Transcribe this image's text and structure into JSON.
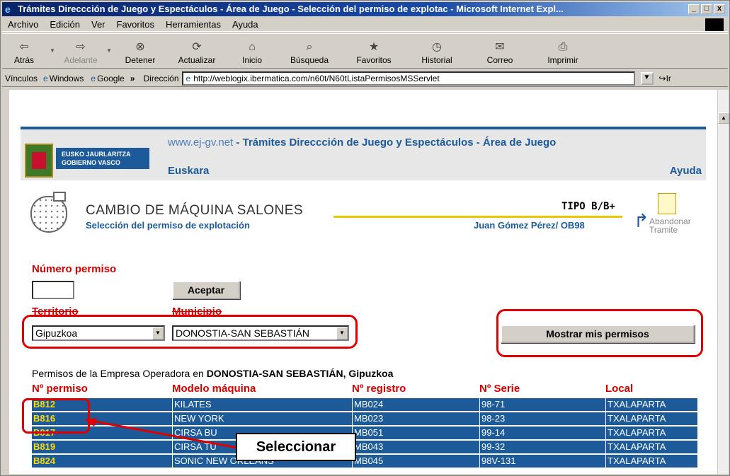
{
  "window": {
    "title": "Trámites Direccción de Juego y Espectáculos - Área de Juego - Selección del permiso de explotac - Microsoft Internet Expl...",
    "buttons": [
      "_",
      "□",
      "x"
    ]
  },
  "menu": [
    "Archivo",
    "Edición",
    "Ver",
    "Favoritos",
    "Herramientas",
    "Ayuda"
  ],
  "toolbar": [
    {
      "label": "Atrás",
      "icon": "back-icon",
      "disabled": false
    },
    {
      "label": "Adelante",
      "icon": "forward-icon",
      "disabled": true
    },
    {
      "label": "Detener",
      "icon": "stop-icon",
      "disabled": false
    },
    {
      "label": "Actualizar",
      "icon": "refresh-icon",
      "disabled": false
    },
    {
      "label": "Inicio",
      "icon": "home-icon",
      "disabled": false
    },
    {
      "label": "Búsqueda",
      "icon": "search-icon",
      "disabled": false
    },
    {
      "label": "Favoritos",
      "icon": "favorites-icon",
      "disabled": false
    },
    {
      "label": "Historial",
      "icon": "history-icon",
      "disabled": false
    },
    {
      "label": "Correo",
      "icon": "mail-icon",
      "disabled": false
    },
    {
      "label": "Imprimir",
      "icon": "print-icon",
      "disabled": false
    }
  ],
  "links_bar": {
    "label": "Vínculos",
    "items": [
      "Windows",
      "Google"
    ],
    "more": "»"
  },
  "address": {
    "label": "Dirección",
    "url": "http://weblogix.ibermatica.com/n60t/N60tListaPermisosMSServlet",
    "go": "Ir"
  },
  "page_header": {
    "logo_line1": "EUSKO JAURLARITZA",
    "logo_line2": "GOBIERNO VASCO",
    "site": "www.ej-gv.net",
    "sep": " - ",
    "title": "Trámites Direccción de Juego y Espectáculos - Área de Juego",
    "lang_link": "Euskara",
    "help_link": "Ayuda"
  },
  "section": {
    "title": "CAMBIO DE MÁQUINA SALONES",
    "subtitle": "Selección del permiso de explotación",
    "tipo": "TIPO B/B+",
    "user": "Juan Gómez Pérez/ OB98",
    "abandon_1": "Abandonar",
    "abandon_2": "Tramite"
  },
  "form": {
    "numero_label": "Número permiso",
    "numero_value": "",
    "aceptar": "Aceptar",
    "territorio_label": "Territorio",
    "territorio_value": "Gipuzkoa",
    "municipio_label": "Municipio",
    "municipio_value": "DONOSTIA-SAN SEBASTIÁN",
    "mostrar": "Mostrar mis permisos"
  },
  "permits": {
    "intro": "Permisos de la Empresa Operadora en",
    "location": "DONOSTIA-SAN SEBASTIÁN, Gipuzkoa",
    "headers": [
      "Nº permiso",
      "Modelo máquina",
      "Nº registro",
      "Nº Serie",
      "Local"
    ],
    "rows": [
      [
        "B812",
        "KILATES",
        "MB024",
        "98-71",
        "TXALAPARTA"
      ],
      [
        "B816",
        "NEW YORK",
        "MB023",
        "98-23",
        "TXALAPARTA"
      ],
      [
        "B817",
        "CIRSA BU",
        "MB051",
        "99-14",
        "TXALAPARTA"
      ],
      [
        "B819",
        "CIRSA TU",
        "MB043",
        "99-32",
        "TXALAPARTA"
      ],
      [
        "B824",
        "SONIC NEW ORLEANS",
        "MB045",
        "98V-131",
        "TXALAPARTA"
      ]
    ]
  },
  "callout": "Seleccionar",
  "colors": {
    "brand_blue": "#1c5a9a",
    "red": "#d40000",
    "permit_yellow": "#ffd800",
    "underline_yellow": "#e8c800"
  }
}
